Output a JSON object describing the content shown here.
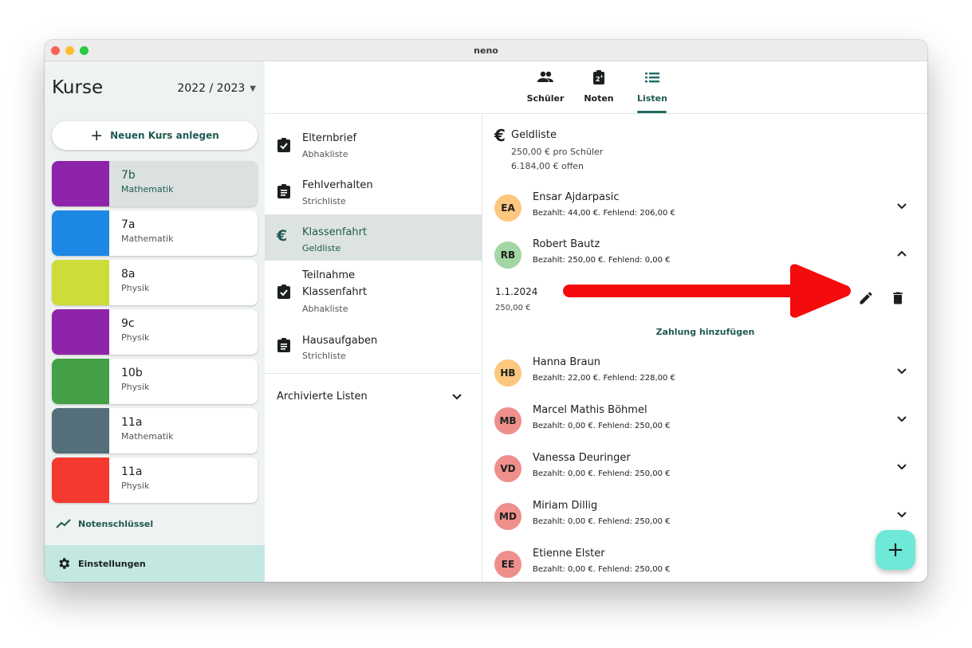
{
  "window": {
    "title": "neno"
  },
  "sidebar": {
    "title": "Kurse",
    "year": "2022 / 2023",
    "new_course_label": "Neuen Kurs anlegen",
    "courses": [
      {
        "name": "7b",
        "subject": "Mathematik",
        "color": "#8e24aa"
      },
      {
        "name": "7a",
        "subject": "Mathematik",
        "color": "#1e88e5"
      },
      {
        "name": "8a",
        "subject": "Physik",
        "color": "#cddc39"
      },
      {
        "name": "9c",
        "subject": "Physik",
        "color": "#8e24aa"
      },
      {
        "name": "10b",
        "subject": "Physik",
        "color": "#43a047"
      },
      {
        "name": "11a",
        "subject": "Mathematik",
        "color": "#546e7a"
      },
      {
        "name": "11a",
        "subject": "Physik",
        "color": "#f4392f"
      }
    ],
    "grading_key_label": "Notenschlüssel",
    "settings_label": "Einstellungen"
  },
  "tabs": [
    {
      "label": "Schüler",
      "icon": "people-icon"
    },
    {
      "label": "Noten",
      "icon": "grades-icon"
    },
    {
      "label": "Listen",
      "icon": "list-icon"
    }
  ],
  "lists": {
    "items": [
      {
        "title": "Elternbrief",
        "subtitle": "Abhakliste",
        "icon": "clipboard-check-icon"
      },
      {
        "title": "Fehlverhalten",
        "subtitle": "Strichliste",
        "icon": "clipboard-lines-icon"
      },
      {
        "title": "Klassenfahrt",
        "subtitle": "Geldliste",
        "icon": "euro-icon"
      },
      {
        "title": "Teilnahme Klassenfahrt",
        "title_line1": "Teilnahme",
        "title_line2": "Klassenfahrt",
        "subtitle": "Abhakliste",
        "icon": "clipboard-check-icon"
      },
      {
        "title": "Hausaufgaben",
        "subtitle": "Strichliste",
        "icon": "clipboard-lines-icon"
      }
    ],
    "archived_label": "Archivierte Listen"
  },
  "detail": {
    "currency_symbol": "€",
    "title": "Geldliste",
    "per_student": "250,00 € pro Schüler",
    "open_amount": "6.184,00 € offen",
    "students": [
      {
        "initials": "EA",
        "name": "Ensar Ajdarpasic",
        "info": "Bezahlt: 44,00 €. Fehlend: 206,00 €",
        "color": "#fdc77f",
        "expanded": false
      },
      {
        "initials": "RB",
        "name": "Robert Bautz",
        "info": "Bezahlt: 250,00 €. Fehlend: 0,00 €",
        "color": "#a3d6a5",
        "expanded": true
      },
      {
        "initials": "HB",
        "name": "Hanna Braun",
        "info": "Bezahlt: 22,00 €. Fehlend: 228,00 €",
        "color": "#fdc77f",
        "expanded": false
      },
      {
        "initials": "MB",
        "name": "Marcel Mathis Böhmel",
        "info": "Bezahlt: 0,00 €. Fehlend: 250,00 €",
        "color": "#ee8f8c",
        "expanded": false
      },
      {
        "initials": "VD",
        "name": "Vanessa Deuringer",
        "info": "Bezahlt: 0,00 €. Fehlend: 250,00 €",
        "color": "#ee8f8c",
        "expanded": false
      },
      {
        "initials": "MD",
        "name": "Miriam Dillig",
        "info": "Bezahlt: 0,00 €. Fehlend: 250,00 €",
        "color": "#ee8f8c",
        "expanded": false
      },
      {
        "initials": "EE",
        "name": "Etienne Elster",
        "info": "Bezahlt: 0,00 €. Fehlend: 250,00 €",
        "color": "#ee8f8c",
        "expanded": false
      }
    ],
    "payment": {
      "date": "1.1.2024",
      "amount": "250,00 €"
    },
    "add_payment_label": "Zahlung hinzufügen"
  },
  "fab_label": "+",
  "colors": {
    "accent": "#1f5a52",
    "selected_bg": "#dbe1df",
    "settings_bg": "#c2e8e1",
    "fab": "#6ee8d7",
    "annotation_arrow": "#f40c0c"
  }
}
